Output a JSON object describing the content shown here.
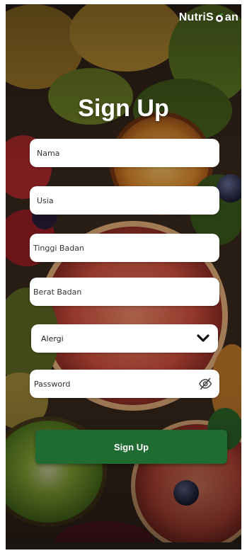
{
  "brand": {
    "prefix": "NutriS",
    "suffix": "an"
  },
  "title": "Sign Up",
  "fields": {
    "nama": {
      "placeholder": "Nama"
    },
    "usia": {
      "placeholder": "Usia"
    },
    "tinggi": {
      "placeholder": "Tinggi Badan"
    },
    "berat": {
      "placeholder": "Berat Badan"
    },
    "alergi": {
      "label": "Alergi"
    },
    "password": {
      "placeholder": "Password"
    }
  },
  "signup_button": {
    "label": "Sign Up"
  },
  "colors": {
    "accent": "#1f6b32",
    "field_bg": "#ffffff",
    "text_light": "#ffffff"
  },
  "icons": {
    "select": "chevron-down-icon",
    "password": "eye-off-icon",
    "brand": "leaf-icon"
  }
}
